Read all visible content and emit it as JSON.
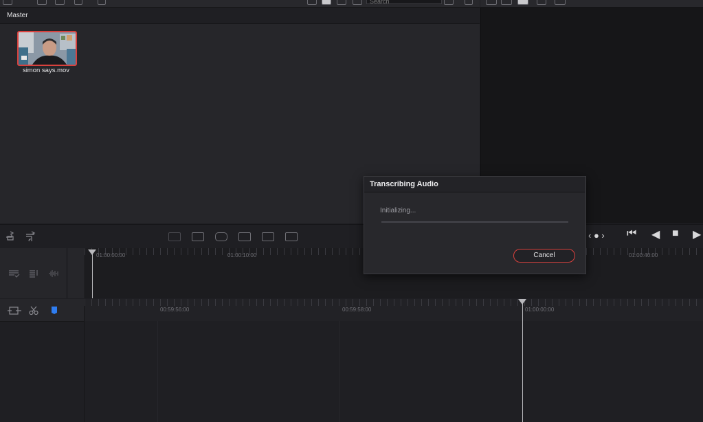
{
  "media_pool": {
    "bin_title": "Master",
    "clip_name": "simon says.mov"
  },
  "toolbar": {
    "search_placeholder": "Search"
  },
  "upper_timeline": {
    "timecodes": [
      "01:00:00:00",
      "01:00:10:00",
      "01:00:40:00"
    ]
  },
  "lower_timeline": {
    "timecodes": [
      "00:59:56:00",
      "00:59:58:00",
      "01:00:00:00"
    ]
  },
  "dialog": {
    "title": "Transcribing Audio",
    "status": "Initializing...",
    "progress": 0,
    "cancel_label": "Cancel"
  },
  "colors": {
    "accent_red": "#d9413d",
    "flag_blue": "#2f7df0"
  }
}
